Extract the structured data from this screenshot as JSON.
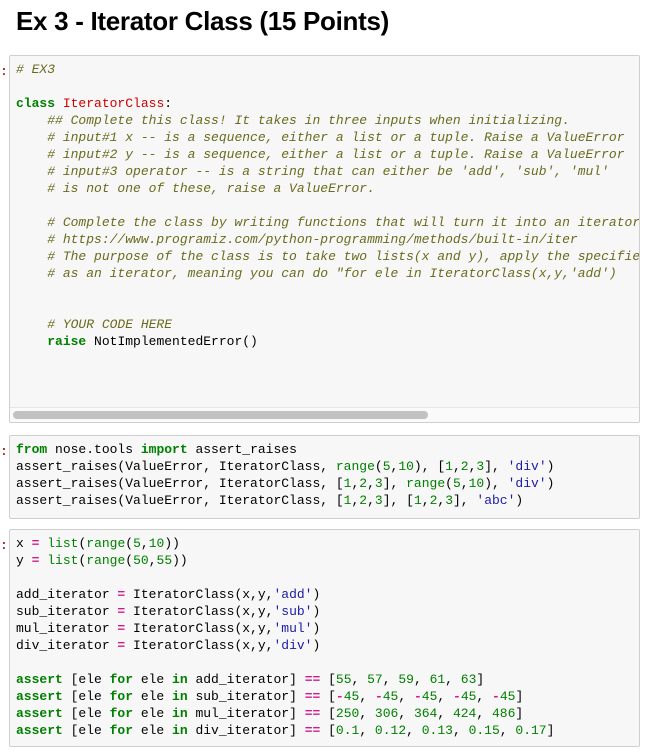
{
  "title": "Ex 3 - Iterator Class (15 Points)",
  "prompt_glyph": ":",
  "cells": [
    {
      "id": "cell-1",
      "lines": [
        [
          {
            "t": "cm",
            "v": "# EX3"
          }
        ],
        [],
        [
          {
            "t": "kw",
            "v": "class"
          },
          {
            "t": "",
            "v": " "
          },
          {
            "t": "cls",
            "v": "IteratorClass"
          },
          {
            "t": "",
            "v": ":"
          }
        ],
        [
          {
            "t": "",
            "v": "    "
          },
          {
            "t": "cm",
            "v": "## Complete this class! It takes in three inputs when initializing."
          }
        ],
        [
          {
            "t": "",
            "v": "    "
          },
          {
            "t": "cm",
            "v": "# input#1 x -- is a sequence, either a list or a tuple. Raise a ValueError"
          }
        ],
        [
          {
            "t": "",
            "v": "    "
          },
          {
            "t": "cm",
            "v": "# input#2 y -- is a sequence, either a list or a tuple. Raise a ValueError"
          }
        ],
        [
          {
            "t": "",
            "v": "    "
          },
          {
            "t": "cm",
            "v": "# input#3 operator -- is a string that can either be 'add', 'sub', 'mul'"
          }
        ],
        [
          {
            "t": "",
            "v": "    "
          },
          {
            "t": "cm",
            "v": "# is not one of these, raise a ValueError."
          }
        ],
        [],
        [
          {
            "t": "",
            "v": "    "
          },
          {
            "t": "cm",
            "v": "# Complete the class by writing functions that will turn it into an iterator"
          }
        ],
        [
          {
            "t": "",
            "v": "    "
          },
          {
            "t": "cm",
            "v": "# https://www.programiz.com/python-programming/methods/built-in/iter"
          }
        ],
        [
          {
            "t": "",
            "v": "    "
          },
          {
            "t": "cm",
            "v": "# The purpose of the class is to take two lists(x and y), apply the specified"
          }
        ],
        [
          {
            "t": "",
            "v": "    "
          },
          {
            "t": "cm",
            "v": "# as an iterator, meaning you can do \"for ele in IteratorClass(x,y,'add')"
          }
        ],
        [],
        [],
        [
          {
            "t": "",
            "v": "    "
          },
          {
            "t": "cm",
            "v": "# YOUR CODE HERE"
          }
        ],
        [
          {
            "t": "",
            "v": "    "
          },
          {
            "t": "kw",
            "v": "raise"
          },
          {
            "t": "",
            "v": " NotImplementedError()"
          }
        ]
      ],
      "scrollbar": {
        "thumb_fraction": 0.66
      }
    },
    {
      "id": "cell-2",
      "lines": [
        [
          {
            "t": "kw",
            "v": "from"
          },
          {
            "t": "",
            "v": " nose.tools "
          },
          {
            "t": "kw",
            "v": "import"
          },
          {
            "t": "",
            "v": " assert_raises"
          }
        ],
        [
          {
            "t": "",
            "v": "assert_raises(ValueError, IteratorClass, "
          },
          {
            "t": "bi",
            "v": "range"
          },
          {
            "t": "",
            "v": "("
          },
          {
            "t": "num",
            "v": "5"
          },
          {
            "t": "",
            "v": ","
          },
          {
            "t": "num",
            "v": "10"
          },
          {
            "t": "",
            "v": "), ["
          },
          {
            "t": "num",
            "v": "1"
          },
          {
            "t": "",
            "v": ","
          },
          {
            "t": "num",
            "v": "2"
          },
          {
            "t": "",
            "v": ","
          },
          {
            "t": "num",
            "v": "3"
          },
          {
            "t": "",
            "v": "], "
          },
          {
            "t": "str",
            "v": "'div'"
          },
          {
            "t": "",
            "v": ")"
          }
        ],
        [
          {
            "t": "",
            "v": "assert_raises(ValueError, IteratorClass, ["
          },
          {
            "t": "num",
            "v": "1"
          },
          {
            "t": "",
            "v": ","
          },
          {
            "t": "num",
            "v": "2"
          },
          {
            "t": "",
            "v": ","
          },
          {
            "t": "num",
            "v": "3"
          },
          {
            "t": "",
            "v": "], "
          },
          {
            "t": "bi",
            "v": "range"
          },
          {
            "t": "",
            "v": "("
          },
          {
            "t": "num",
            "v": "5"
          },
          {
            "t": "",
            "v": ","
          },
          {
            "t": "num",
            "v": "10"
          },
          {
            "t": "",
            "v": "), "
          },
          {
            "t": "str",
            "v": "'div'"
          },
          {
            "t": "",
            "v": ")"
          }
        ],
        [
          {
            "t": "",
            "v": "assert_raises(ValueError, IteratorClass, ["
          },
          {
            "t": "num",
            "v": "1"
          },
          {
            "t": "",
            "v": ","
          },
          {
            "t": "num",
            "v": "2"
          },
          {
            "t": "",
            "v": ","
          },
          {
            "t": "num",
            "v": "3"
          },
          {
            "t": "",
            "v": "], ["
          },
          {
            "t": "num",
            "v": "1"
          },
          {
            "t": "",
            "v": ","
          },
          {
            "t": "num",
            "v": "2"
          },
          {
            "t": "",
            "v": ","
          },
          {
            "t": "num",
            "v": "3"
          },
          {
            "t": "",
            "v": "], "
          },
          {
            "t": "str",
            "v": "'abc'"
          },
          {
            "t": "",
            "v": ")"
          }
        ]
      ]
    },
    {
      "id": "cell-3",
      "lines": [
        [
          {
            "t": "",
            "v": "x "
          },
          {
            "t": "op",
            "v": "="
          },
          {
            "t": "",
            "v": " "
          },
          {
            "t": "bi",
            "v": "list"
          },
          {
            "t": "",
            "v": "("
          },
          {
            "t": "bi",
            "v": "range"
          },
          {
            "t": "",
            "v": "("
          },
          {
            "t": "num",
            "v": "5"
          },
          {
            "t": "",
            "v": ","
          },
          {
            "t": "num",
            "v": "10"
          },
          {
            "t": "",
            "v": "))"
          }
        ],
        [
          {
            "t": "",
            "v": "y "
          },
          {
            "t": "op",
            "v": "="
          },
          {
            "t": "",
            "v": " "
          },
          {
            "t": "bi",
            "v": "list"
          },
          {
            "t": "",
            "v": "("
          },
          {
            "t": "bi",
            "v": "range"
          },
          {
            "t": "",
            "v": "("
          },
          {
            "t": "num",
            "v": "50"
          },
          {
            "t": "",
            "v": ","
          },
          {
            "t": "num",
            "v": "55"
          },
          {
            "t": "",
            "v": "))"
          }
        ],
        [],
        [
          {
            "t": "",
            "v": "add_iterator "
          },
          {
            "t": "op",
            "v": "="
          },
          {
            "t": "",
            "v": " IteratorClass(x,y,"
          },
          {
            "t": "str",
            "v": "'add'"
          },
          {
            "t": "",
            "v": ")"
          }
        ],
        [
          {
            "t": "",
            "v": "sub_iterator "
          },
          {
            "t": "op",
            "v": "="
          },
          {
            "t": "",
            "v": " IteratorClass(x,y,"
          },
          {
            "t": "str",
            "v": "'sub'"
          },
          {
            "t": "",
            "v": ")"
          }
        ],
        [
          {
            "t": "",
            "v": "mul_iterator "
          },
          {
            "t": "op",
            "v": "="
          },
          {
            "t": "",
            "v": " IteratorClass(x,y,"
          },
          {
            "t": "str",
            "v": "'mul'"
          },
          {
            "t": "",
            "v": ")"
          }
        ],
        [
          {
            "t": "",
            "v": "div_iterator "
          },
          {
            "t": "op",
            "v": "="
          },
          {
            "t": "",
            "v": " IteratorClass(x,y,"
          },
          {
            "t": "str",
            "v": "'div'"
          },
          {
            "t": "",
            "v": ")"
          }
        ],
        [],
        [
          {
            "t": "kw",
            "v": "assert"
          },
          {
            "t": "",
            "v": " [ele "
          },
          {
            "t": "kw",
            "v": "for"
          },
          {
            "t": "",
            "v": " ele "
          },
          {
            "t": "kw",
            "v": "in"
          },
          {
            "t": "",
            "v": " add_iterator] "
          },
          {
            "t": "op",
            "v": "=="
          },
          {
            "t": "",
            "v": " ["
          },
          {
            "t": "num",
            "v": "55"
          },
          {
            "t": "",
            "v": ", "
          },
          {
            "t": "num",
            "v": "57"
          },
          {
            "t": "",
            "v": ", "
          },
          {
            "t": "num",
            "v": "59"
          },
          {
            "t": "",
            "v": ", "
          },
          {
            "t": "num",
            "v": "61"
          },
          {
            "t": "",
            "v": ", "
          },
          {
            "t": "num",
            "v": "63"
          },
          {
            "t": "",
            "v": "]"
          }
        ],
        [
          {
            "t": "kw",
            "v": "assert"
          },
          {
            "t": "",
            "v": " [ele "
          },
          {
            "t": "kw",
            "v": "for"
          },
          {
            "t": "",
            "v": " ele "
          },
          {
            "t": "kw",
            "v": "in"
          },
          {
            "t": "",
            "v": " sub_iterator] "
          },
          {
            "t": "op",
            "v": "=="
          },
          {
            "t": "",
            "v": " ["
          },
          {
            "t": "op",
            "v": "-"
          },
          {
            "t": "num",
            "v": "45"
          },
          {
            "t": "",
            "v": ", "
          },
          {
            "t": "op",
            "v": "-"
          },
          {
            "t": "num",
            "v": "45"
          },
          {
            "t": "",
            "v": ", "
          },
          {
            "t": "op",
            "v": "-"
          },
          {
            "t": "num",
            "v": "45"
          },
          {
            "t": "",
            "v": ", "
          },
          {
            "t": "op",
            "v": "-"
          },
          {
            "t": "num",
            "v": "45"
          },
          {
            "t": "",
            "v": ", "
          },
          {
            "t": "op",
            "v": "-"
          },
          {
            "t": "num",
            "v": "45"
          },
          {
            "t": "",
            "v": "]"
          }
        ],
        [
          {
            "t": "kw",
            "v": "assert"
          },
          {
            "t": "",
            "v": " [ele "
          },
          {
            "t": "kw",
            "v": "for"
          },
          {
            "t": "",
            "v": " ele "
          },
          {
            "t": "kw",
            "v": "in"
          },
          {
            "t": "",
            "v": " mul_iterator] "
          },
          {
            "t": "op",
            "v": "=="
          },
          {
            "t": "",
            "v": " ["
          },
          {
            "t": "num",
            "v": "250"
          },
          {
            "t": "",
            "v": ", "
          },
          {
            "t": "num",
            "v": "306"
          },
          {
            "t": "",
            "v": ", "
          },
          {
            "t": "num",
            "v": "364"
          },
          {
            "t": "",
            "v": ", "
          },
          {
            "t": "num",
            "v": "424"
          },
          {
            "t": "",
            "v": ", "
          },
          {
            "t": "num",
            "v": "486"
          },
          {
            "t": "",
            "v": "]"
          }
        ],
        [
          {
            "t": "kw",
            "v": "assert"
          },
          {
            "t": "",
            "v": " [ele "
          },
          {
            "t": "kw",
            "v": "for"
          },
          {
            "t": "",
            "v": " ele "
          },
          {
            "t": "kw",
            "v": "in"
          },
          {
            "t": "",
            "v": " div_iterator] "
          },
          {
            "t": "op",
            "v": "=="
          },
          {
            "t": "",
            "v": " ["
          },
          {
            "t": "num",
            "v": "0.1"
          },
          {
            "t": "",
            "v": ", "
          },
          {
            "t": "num",
            "v": "0.12"
          },
          {
            "t": "",
            "v": ", "
          },
          {
            "t": "num",
            "v": "0.13"
          },
          {
            "t": "",
            "v": ", "
          },
          {
            "t": "num",
            "v": "0.15"
          },
          {
            "t": "",
            "v": ", "
          },
          {
            "t": "num",
            "v": "0.17"
          },
          {
            "t": "",
            "v": "]"
          }
        ]
      ]
    }
  ]
}
